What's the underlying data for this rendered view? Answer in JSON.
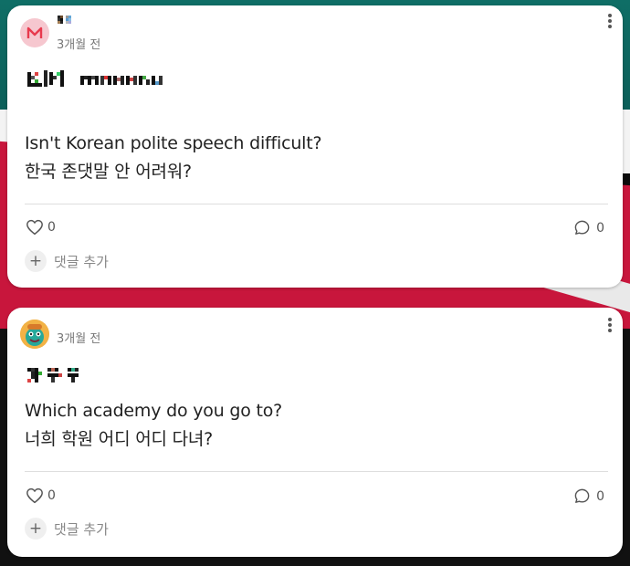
{
  "posts": [
    {
      "time": "3개월 전",
      "body_line1": "Isn't Korean polite speech difficult?",
      "body_line2": "한국 존댓말 안 어려워?",
      "likes": "0",
      "comments": "0",
      "add_comment_label": "댓글 추가"
    },
    {
      "time": "3개월 전",
      "body_line1": "Which academy do you go to?",
      "body_line2": "너희 학원 어디 어디 다녀?",
      "likes": "0",
      "comments": "0",
      "add_comment_label": "댓글 추가"
    }
  ],
  "icons": {
    "like": "heart-icon",
    "comment": "comment-bubble-icon",
    "add": "plus-icon",
    "more": "more-vertical-icon"
  },
  "colors": {
    "card_bg": "#ffffff",
    "text_primary": "#222222",
    "text_secondary": "#777777",
    "avatar1_bg": "#f6c7cf",
    "avatar2_bg": "#f2b245"
  }
}
